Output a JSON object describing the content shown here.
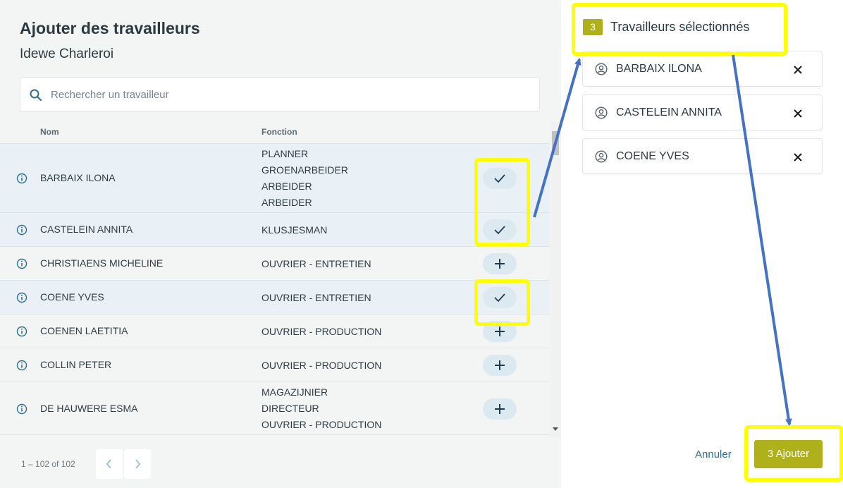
{
  "left_panel": {
    "title": "Ajouter des travailleurs",
    "subtitle": "Idewe Charleroi",
    "search": {
      "placeholder": "Rechercher un travailleur",
      "icon": "search-icon"
    },
    "columns": {
      "nom": "Nom",
      "fonction": "Fonction"
    },
    "rows": [
      {
        "name": "BARBAIX ILONA",
        "functions": [
          "PLANNER",
          "GROENARBEIDER",
          "ARBEIDER",
          "ARBEIDER"
        ],
        "selected": true
      },
      {
        "name": "CASTELEIN ANNITA",
        "functions": [
          "KLUSJESMAN"
        ],
        "selected": true
      },
      {
        "name": "CHRISTIAENS MICHELINE",
        "functions": [
          "OUVRIER - ENTRETIEN"
        ],
        "selected": false
      },
      {
        "name": "COENE YVES",
        "functions": [
          "OUVRIER - ENTRETIEN"
        ],
        "selected": true
      },
      {
        "name": "COENEN LAETITIA",
        "functions": [
          "OUVRIER - PRODUCTION"
        ],
        "selected": false
      },
      {
        "name": "COLLIN PETER",
        "functions": [
          "OUVRIER - PRODUCTION"
        ],
        "selected": false
      },
      {
        "name": "DE HAUWERE ESMA",
        "functions": [
          "MAGAZIJNIER",
          "DIRECTEUR",
          "OUVRIER - PRODUCTION"
        ],
        "selected": false
      }
    ],
    "pagination": {
      "range_text": "1 – 102 of 102"
    }
  },
  "right_panel": {
    "count": "3",
    "title": "Travailleurs sélectionnés",
    "selected": [
      "BARBAIX ILONA",
      "CASTELEIN ANNITA",
      "COENE YVES"
    ],
    "cancel_label": "Annuler",
    "add_label": "3 Ajouter"
  },
  "colors": {
    "accent": "#b0b11a",
    "selected_row": "#e9f1f6",
    "annotation_highlight": "#ffff00",
    "annotation_arrow": "#4472c4",
    "link": "#2f6f99"
  }
}
